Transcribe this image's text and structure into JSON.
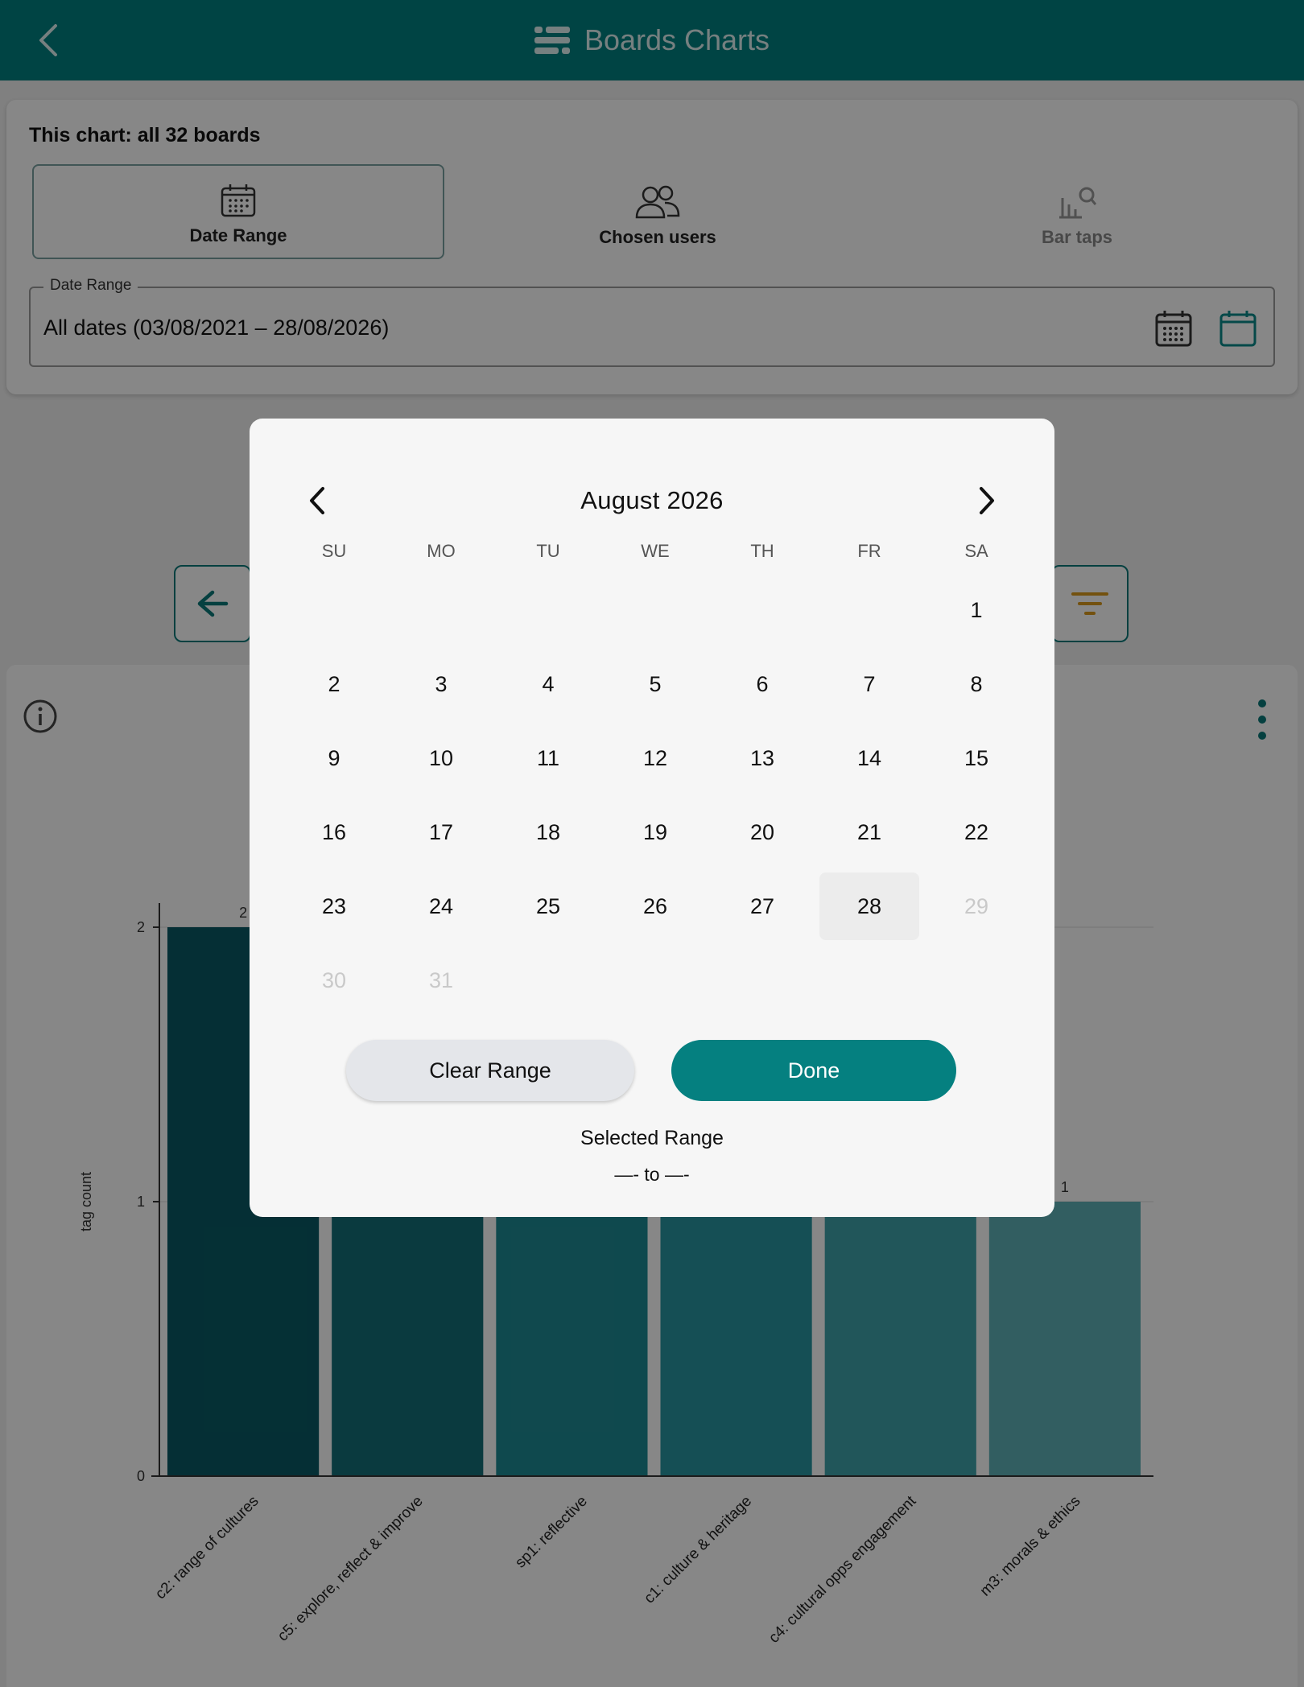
{
  "header": {
    "title": "Boards Charts",
    "back_icon": "chevron-left-icon",
    "title_icon": "boards-icon",
    "bg_color": "#008080"
  },
  "filters": {
    "scope_text": "This chart: all 32 boards",
    "tabs": [
      {
        "label": "Date Range",
        "icon": "calendar-icon",
        "state": "active"
      },
      {
        "label": "Chosen users",
        "icon": "users-icon",
        "state": "normal"
      },
      {
        "label": "Bar taps",
        "icon": "bar-search-icon",
        "state": "disabled"
      }
    ],
    "date_field": {
      "label": "Date Range",
      "value": "All dates (03/08/2021 – 28/08/2026)"
    }
  },
  "chart_data": {
    "type": "bar",
    "categories": [
      "c2: range of cultures",
      "c5: explore, reflect & improve",
      "sp1: reflective",
      "c1: culture & heritage",
      "c4: cultural opps engagement",
      "m3: morals & ethics"
    ],
    "values": [
      2,
      1,
      1,
      1,
      1,
      1
    ],
    "data_labels": [
      "2",
      "",
      "",
      "",
      "",
      "1"
    ],
    "ylabel": "tag count",
    "ylim": [
      0,
      2
    ],
    "yticks": [
      "0",
      "1",
      "2"
    ],
    "colors": [
      "#0a5a64",
      "#136e78",
      "#1e8a93",
      "#2896a0",
      "#3fa3aa",
      "#5fb2b8"
    ]
  },
  "calendar": {
    "month_title": "August 2026",
    "weekdays": [
      "SU",
      "MO",
      "TU",
      "WE",
      "TH",
      "FR",
      "SA"
    ],
    "first_weekday_index": 6,
    "days_in_month": 31,
    "today": 28,
    "disabled_from": 29,
    "clear_label": "Clear Range",
    "done_label": "Done",
    "selected_label": "Selected Range",
    "selected_value": "—-  to —-"
  }
}
